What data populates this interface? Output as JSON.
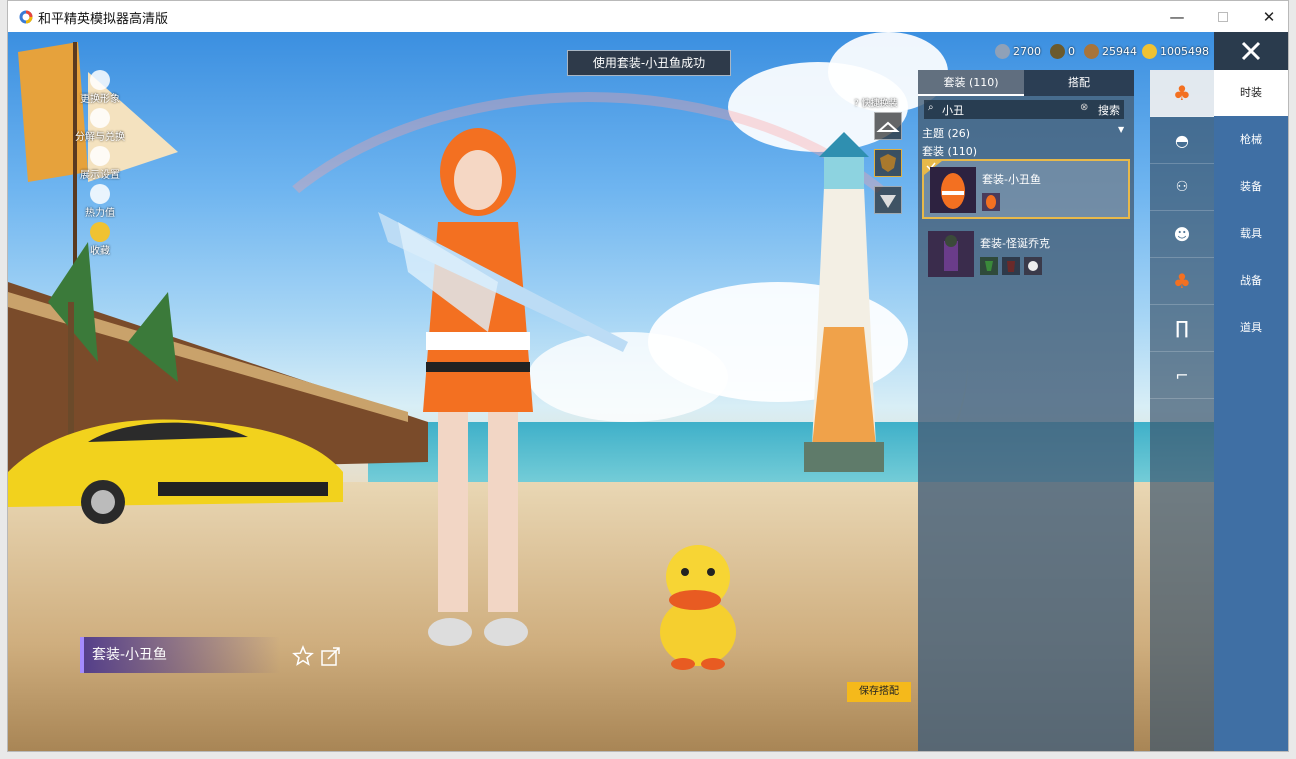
{
  "window": {
    "title": "和平精英模拟器高清版"
  },
  "toast": "使用套装-小丑鱼成功",
  "currency": [
    {
      "icon": "silver-coin-icon",
      "value": "2700",
      "color": "#8fa1b8"
    },
    {
      "icon": "token-icon",
      "value": "0",
      "color": "#6b5a2d"
    },
    {
      "icon": "bronze-coin-icon",
      "value": "25944",
      "color": "#a8743a"
    },
    {
      "icon": "gold-coin-icon",
      "value": "1005498",
      "color": "#f0c232"
    }
  ],
  "left_menu": [
    {
      "label": "更换形象",
      "icon": "avatar-icon"
    },
    {
      "label": "分解与兑换",
      "icon": "dice-icon"
    },
    {
      "label": "展示设置",
      "icon": "eye-icon"
    },
    {
      "label": "热力值",
      "icon": "flame-icon"
    },
    {
      "label": "收藏",
      "icon": "badge-icon"
    }
  ],
  "swap_label": "快捷换装",
  "panel": {
    "tabs": [
      "套装 (110)",
      "搭配"
    ],
    "search_value": "小丑",
    "search_button": "搜索",
    "theme_label": "主题 (26)",
    "suit_label": "套装 (110)",
    "items": [
      {
        "name": "套装-小丑鱼",
        "selected": true
      },
      {
        "name": "套装-怪诞乔克",
        "selected": false
      }
    ]
  },
  "categories": [
    "时装",
    "枪械",
    "装备",
    "载具",
    "战备",
    "道具"
  ],
  "side_icons": [
    "outfit-icon",
    "hat-icon",
    "glasses-icon",
    "mask-icon",
    "top-icon",
    "pants-icon",
    "shoes-icon"
  ],
  "outfit_name": "套装-小丑鱼",
  "save_button": "保存搭配",
  "colors": {
    "accent": "#f5b91b",
    "panel": "#46607a",
    "category_bar": "#3f6fa4"
  }
}
